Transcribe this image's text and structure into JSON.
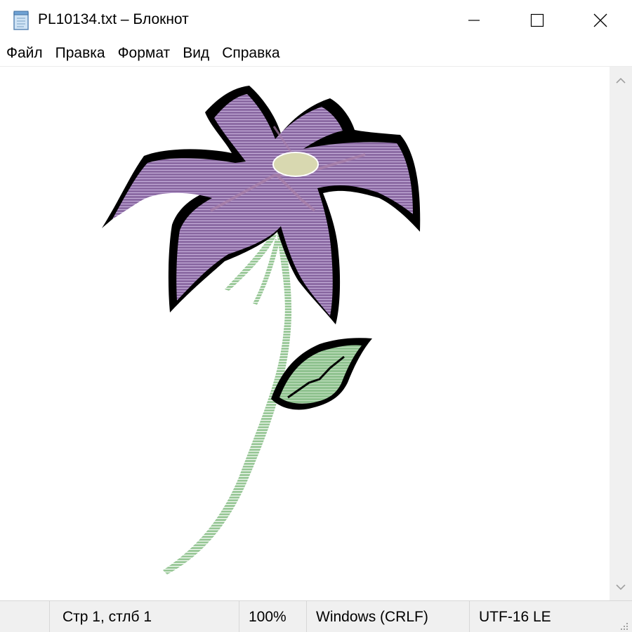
{
  "window": {
    "title": "PL10134.txt – Блокнот",
    "icon": "notepad-icon"
  },
  "title_buttons": {
    "minimize_icon": "minimize-icon",
    "maximize_icon": "maximize-icon",
    "close_icon": "close-icon"
  },
  "menu": {
    "items": [
      {
        "label": "Файл"
      },
      {
        "label": "Правка"
      },
      {
        "label": "Формат"
      },
      {
        "label": "Вид"
      },
      {
        "label": "Справка"
      }
    ]
  },
  "editor": {
    "content_description_icon": "ascii-art-flower",
    "colors": {
      "petal": "#8b6aa3",
      "petal_line": "#c9b3dd",
      "outline": "#000000",
      "stem": "#9bc99a",
      "center": "#d8d8b0"
    }
  },
  "scrollbar": {
    "up_icon": "chevron-up-icon",
    "down_icon": "chevron-down-icon"
  },
  "status": {
    "position": "Стр 1, стлб 1",
    "zoom": "100%",
    "line_endings": "Windows (CRLF)",
    "encoding": "UTF-16 LE"
  }
}
